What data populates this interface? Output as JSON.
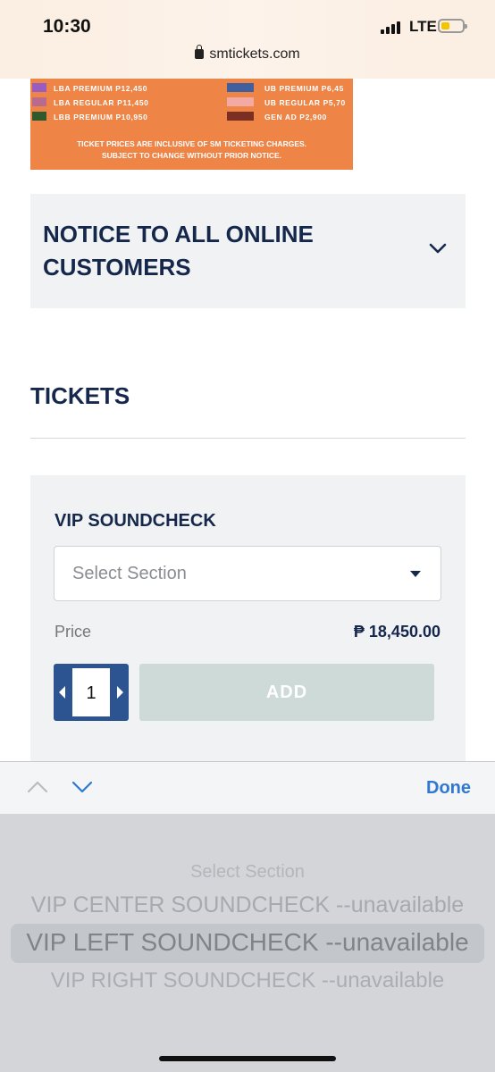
{
  "status_bar": {
    "time": "10:30",
    "network": "LTE",
    "url": "smtickets.com"
  },
  "banner": {
    "left_items": [
      {
        "label": "LBA PREMIUM P12,450",
        "color": "#9a5cc0"
      },
      {
        "label": "LBA  REGULAR P11,450",
        "color": "#b86b8e"
      },
      {
        "label": "LBB PREMIUM P10,950",
        "color": "#2f5a2e"
      }
    ],
    "right_items": [
      {
        "label": "UB PREMIUM P6,45",
        "color": "#3f5f9e"
      },
      {
        "label": "UB REGULAR P5,70",
        "color": "#f3a9a4"
      },
      {
        "label": "GEN AD P2,900",
        "color": "#7a2f22"
      }
    ],
    "note_line1": "TICKET PRICES ARE INCLUSIVE OF SM TICKETING CHARGES.",
    "note_line2": "SUBJECT TO CHANGE WITHOUT PRIOR NOTICE."
  },
  "notice": {
    "title": "NOTICE TO ALL ONLINE CUSTOMERS"
  },
  "tickets": {
    "heading": "TICKETS",
    "card": {
      "name": "VIP SOUNDCHECK",
      "select_placeholder": "Select Section",
      "price_label": "Price",
      "price_value": "₱ 18,450.00",
      "quantity": "1",
      "add_label": "ADD"
    }
  },
  "keyboard": {
    "done_label": "Done",
    "picker_options": [
      "Select Section",
      "VIP CENTER SOUNDCHECK --unavailable",
      "VIP LEFT SOUNDCHECK --unavailable",
      "VIP RIGHT SOUNDCHECK --unavailable"
    ]
  },
  "colors": {
    "navy": "#15284b",
    "banner_orange": "#ee8446",
    "stepper_blue": "#2c5491",
    "link_blue": "#2f78d2"
  }
}
